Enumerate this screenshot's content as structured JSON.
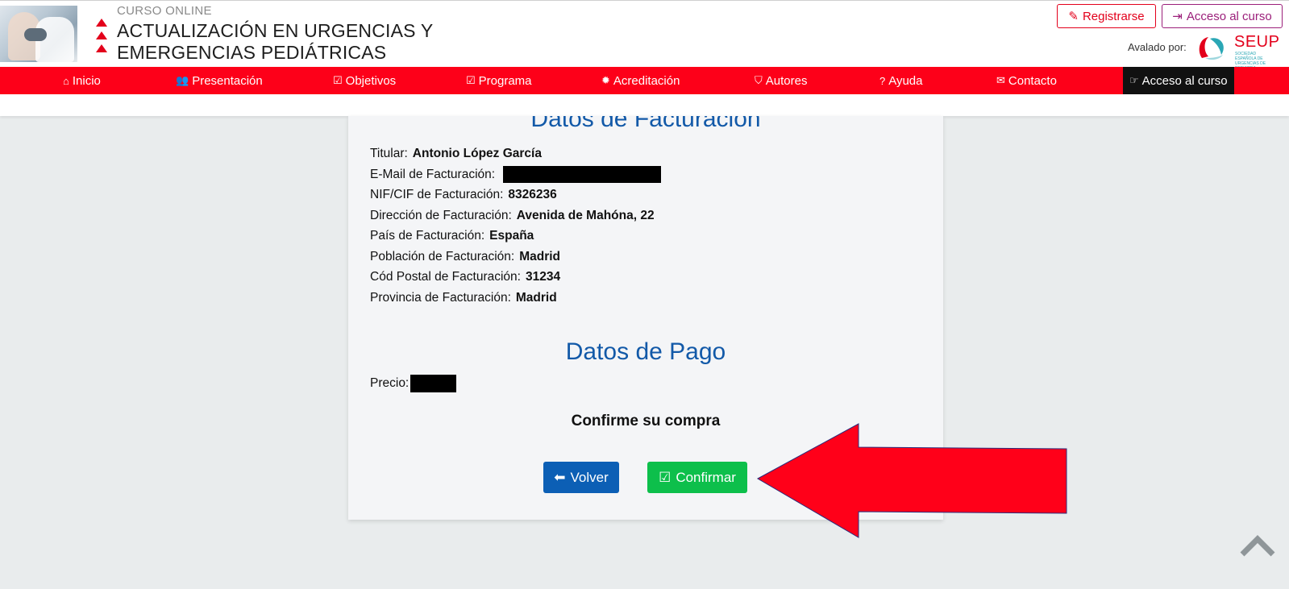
{
  "header": {
    "course_label": "CURSO ONLINE",
    "title_line1": "ACTUALIZACIÓN EN URGENCIAS Y",
    "title_line2": "EMERGENCIAS PEDIÁTRICAS",
    "register_label": "Registrarse",
    "access_label": "Acceso al curso",
    "endorsed_label": "Avalado por:",
    "seup_name": "SEUP",
    "seup_subtitle": "SOCIEDAD ESPAÑOLA DE URGENCIAS DE PEDIATRÍA"
  },
  "nav": {
    "items": [
      {
        "label": "Inicio",
        "icon": "home-icon"
      },
      {
        "label": "Presentación",
        "icon": "users-icon"
      },
      {
        "label": "Objetivos",
        "icon": "check-square-icon"
      },
      {
        "label": "Programa",
        "icon": "calendar-check-icon"
      },
      {
        "label": "Acreditación",
        "icon": "certificate-icon"
      },
      {
        "label": "Autores",
        "icon": "shield-icon"
      },
      {
        "label": "Ayuda",
        "icon": "question-circle-icon"
      },
      {
        "label": "Contacto",
        "icon": "envelope-icon"
      },
      {
        "label": "Acceso al curso",
        "icon": "hand-pointer-icon"
      }
    ]
  },
  "billing": {
    "title": "Datos de Facturación",
    "fields": [
      {
        "label": "Titular:",
        "value": "Antonio López García"
      },
      {
        "label": "E-Mail de Facturación:",
        "value": ""
      },
      {
        "label": "NIF/CIF de Facturación:",
        "value": "8326236"
      },
      {
        "label": "Dirección de Facturación:",
        "value": "Avenida de Mahóna, 22"
      },
      {
        "label": "País de Facturación:",
        "value": "España"
      },
      {
        "label": "Población de Facturación:",
        "value": "Madrid"
      },
      {
        "label": "Cód Postal de Facturación:",
        "value": "31234"
      },
      {
        "label": "Provincia de Facturación:",
        "value": "Madrid"
      }
    ]
  },
  "payment": {
    "title": "Datos de Pago",
    "price_label": "Precio:",
    "confirm_prompt": "Confirme su compra",
    "back_label": "Volver",
    "confirm_label": "Confirmar"
  },
  "colors": {
    "brand_red": "#fd0019",
    "title_blue": "#1259a8",
    "back_blue": "#0c5fb5",
    "confirm_green": "#0dbf4b",
    "access_purple": "#9b1f7a"
  }
}
